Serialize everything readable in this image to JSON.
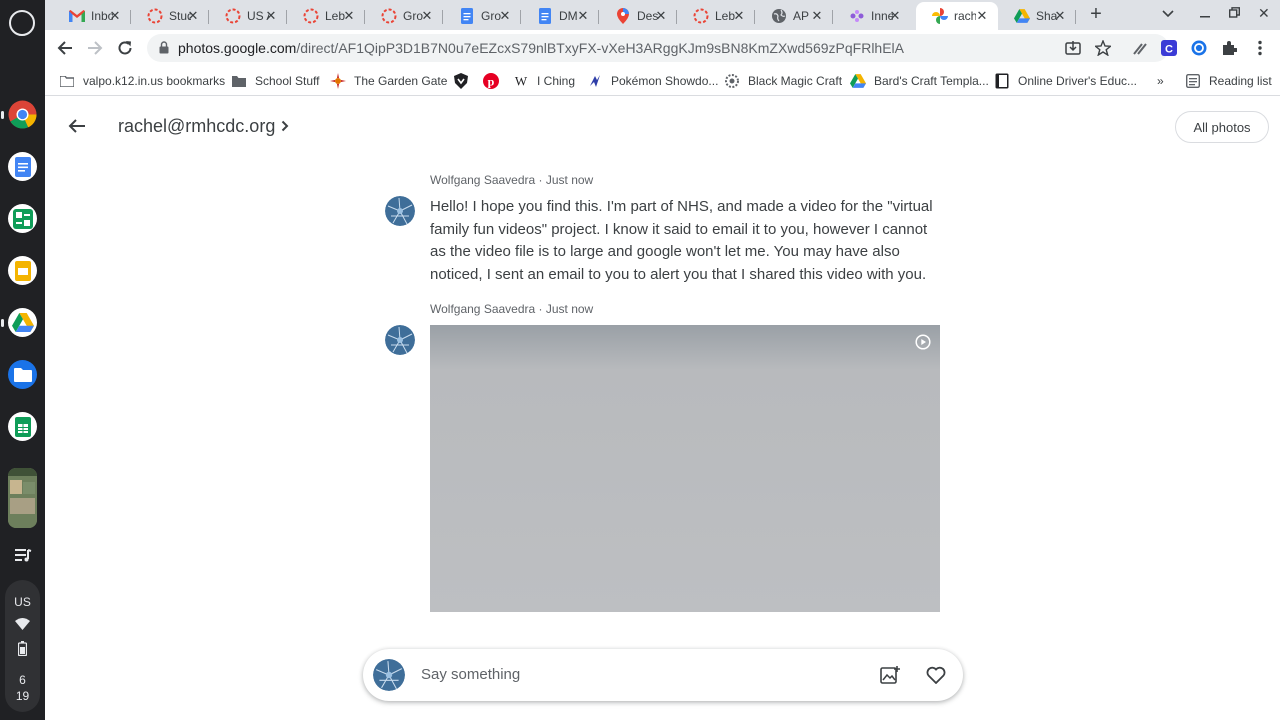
{
  "shelf": {
    "apps": [
      {
        "name": "Chrome",
        "icon": "chrome-icon"
      },
      {
        "name": "Docs",
        "icon": "docs-icon"
      },
      {
        "name": "Sheets add-on",
        "icon": "sheets-plus-icon"
      },
      {
        "name": "Slides",
        "icon": "slides-icon"
      },
      {
        "name": "Drive",
        "icon": "drive-icon"
      },
      {
        "name": "Files",
        "icon": "files-icon"
      },
      {
        "name": "Sheets",
        "icon": "sheets-icon"
      },
      {
        "name": "Photos",
        "icon": "photo-thumbnail-icon"
      },
      {
        "name": "Playlist",
        "icon": "playlist-icon"
      }
    ],
    "status": {
      "ime": "US",
      "time_hour": "6",
      "time_minute": "19"
    }
  },
  "tabs": [
    {
      "title": "Inbox",
      "icon": "gmail-icon",
      "active": false
    },
    {
      "title": "Stud",
      "icon": "spinner-icon",
      "active": false
    },
    {
      "title": "US A",
      "icon": "spinner-icon",
      "active": false
    },
    {
      "title": "Leb",
      "icon": "spinner-icon",
      "active": false
    },
    {
      "title": "Gro",
      "icon": "spinner-icon",
      "active": false
    },
    {
      "title": "Gro",
      "icon": "docs-icon",
      "active": false
    },
    {
      "title": "DM",
      "icon": "docs-icon",
      "active": false
    },
    {
      "title": "Des",
      "icon": "maps-pin-icon",
      "active": false
    },
    {
      "title": "Leb",
      "icon": "spinner-icon",
      "active": false
    },
    {
      "title": "AP",
      "icon": "globe-icon",
      "active": false
    },
    {
      "title": "Inne",
      "icon": "dots-icon",
      "active": false
    },
    {
      "title": "rach",
      "icon": "photos-icon",
      "active": true
    },
    {
      "title": "Sha",
      "icon": "drive-icon",
      "active": false
    }
  ],
  "toolbar": {
    "url_host": "photos.google.com",
    "url_path": "/direct/AF1QipP3D1B7N0u7eEZcxS79nlBTxyFX-vXeH3ARggKJm9sBN8KmZXwd569zPqFRlhElA"
  },
  "bookmarks": [
    {
      "label": "valpo.k12.in.us bookmarks",
      "icon": "folder-icon"
    },
    {
      "label": "School Stuff",
      "icon": "folder-icon"
    },
    {
      "label": "The Garden Gate",
      "icon": "garden-icon"
    },
    {
      "label": "",
      "icon": "shield-icon"
    },
    {
      "label": "",
      "icon": "pinterest-icon"
    },
    {
      "label": "I Ching",
      "icon": "wikipedia-icon"
    },
    {
      "label": "Pokémon Showdo...",
      "icon": "showdown-icon"
    },
    {
      "label": "Black Magic Craft",
      "icon": "craft-icon"
    },
    {
      "label": "Bard's Craft Templa...",
      "icon": "drive-icon"
    },
    {
      "label": "Online Driver's Educ...",
      "icon": "book-icon"
    }
  ],
  "reading_list": "Reading list",
  "page": {
    "album_title": "rachel@rmhcdc.org",
    "all_photos": "All photos",
    "messages": [
      {
        "author": "Wolfgang Saavedra",
        "time": "Just now",
        "text": "Hello! I hope you find this. I'm part of NHS, and made a video for the \"virtual family fun videos\" project. I know it said to email it to you, however I cannot as the video file is to large and google won't let me. You may have also noticed, I sent an email to you to alert you that I shared this video with you."
      },
      {
        "author": "Wolfgang Saavedra",
        "time": "Just now",
        "media": "video"
      }
    ],
    "composer_placeholder": "Say something"
  },
  "colors": {
    "accent": "#1a73e8",
    "tab_strip": "#dee1e6",
    "shelf": "#202124"
  }
}
